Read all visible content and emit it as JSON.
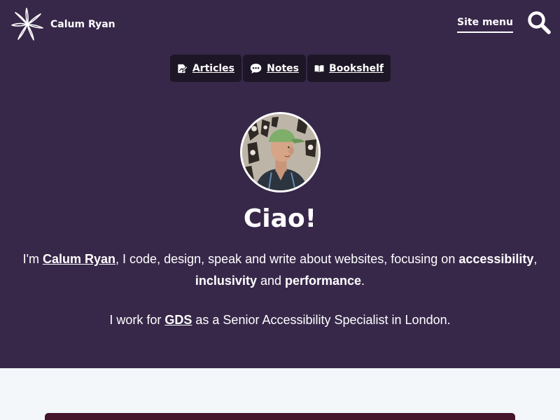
{
  "header": {
    "site_name": "Calum Ryan",
    "menu_label": "Site menu",
    "search_icon": "search-icon"
  },
  "nav": {
    "items": [
      {
        "label": "Articles",
        "icon": "article-edit-icon"
      },
      {
        "label": "Notes",
        "icon": "speech-bubble-icon"
      },
      {
        "label": "Bookshelf",
        "icon": "open-book-icon"
      }
    ]
  },
  "hero": {
    "greeting": "Ciao!",
    "intro": {
      "prefix": "I'm ",
      "name_link": "Calum Ryan",
      "middle": ", I code, design, speak and write about websites, focusing on ",
      "focus_1": "accessibility",
      "sep_1": ", ",
      "focus_2": "inclusivity",
      "sep_2": " and ",
      "focus_3": "performance",
      "suffix": "."
    },
    "work": {
      "prefix": "I work for ",
      "org_link": "GDS",
      "suffix": " as a Senior Accessibility Specialist in London."
    }
  },
  "colors": {
    "hero_bg": "#37284a",
    "pill_bg": "#1d1626",
    "page_bg": "#f4f7fa",
    "card_bg": "#46162d"
  }
}
